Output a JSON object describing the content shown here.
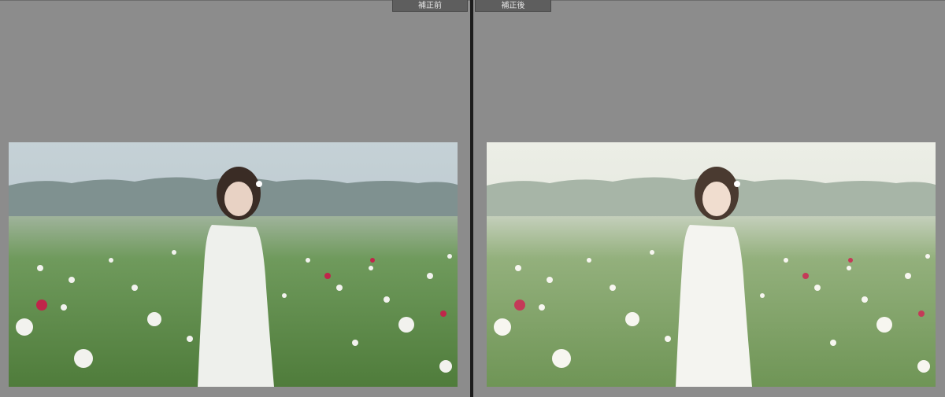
{
  "panes": {
    "before": {
      "label": "補正前"
    },
    "after": {
      "label": "補正後"
    }
  },
  "colors": {
    "background": "#8c8c8c",
    "divider": "#1c1c1c",
    "label_bg": "#5e5e5e",
    "label_text": "#e6e6e6"
  },
  "photos": {
    "before": {
      "sky": "#b9c6cc",
      "treeline": "#7f9190",
      "field": "#5d8a48"
    },
    "after": {
      "sky": "#e3e6dc",
      "treeline": "#a7b5a7",
      "field": "#7ea266"
    }
  }
}
